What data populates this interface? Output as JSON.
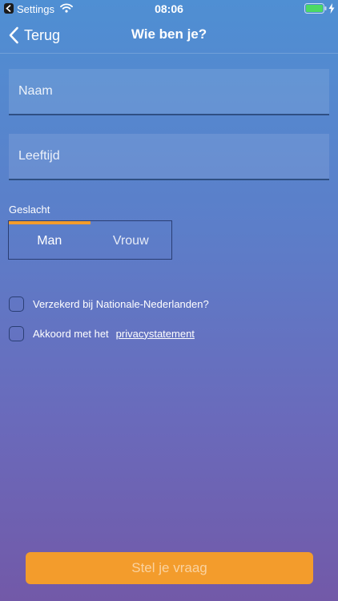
{
  "status_bar": {
    "app_label": "Settings",
    "time": "08:06"
  },
  "nav": {
    "back_label": "Terug",
    "title": "Wie ben je?"
  },
  "form": {
    "name_placeholder": "Naam",
    "age_placeholder": "Leeftijd",
    "gender_label": "Geslacht",
    "gender_options": [
      "Man",
      "Vrouw"
    ],
    "gender_selected": "Man",
    "insured_label": "Verzekerd bij Nationale-Nederlanden?",
    "insured_checked": false,
    "agree_label": "Akkoord met het",
    "privacy_link": "privacystatement",
    "agree_checked": false
  },
  "cta": {
    "label": "Stel je vraag"
  },
  "colors": {
    "accent": "#f39c2c",
    "bg_top": "#4f8fd3",
    "bg_bottom": "#7259a8",
    "border": "#2a3e74"
  },
  "icons": [
    "back-app-icon",
    "wifi-icon",
    "battery-icon",
    "charging-icon",
    "chevron-back-icon"
  ]
}
